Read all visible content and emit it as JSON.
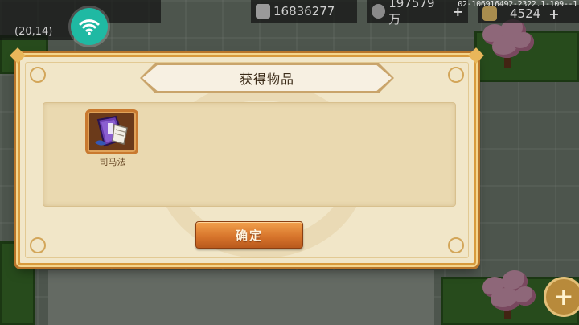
{
  "hud": {
    "coords": "(20,14)",
    "resource1_value": "16836277",
    "resource2_value": "197579万",
    "resource3_value": "4524",
    "plus_glyph": "+",
    "build_info": "02-106916492-2322.1-109--1"
  },
  "dialog": {
    "title": "获得物品",
    "items": [
      {
        "name": "司马法",
        "icon": "purple-book-icon"
      }
    ],
    "confirm_label": "确定"
  },
  "colors": {
    "accent": "#d5722a",
    "dialog_bg": "#f1e6c8",
    "wifi": "#1fb9a3"
  }
}
